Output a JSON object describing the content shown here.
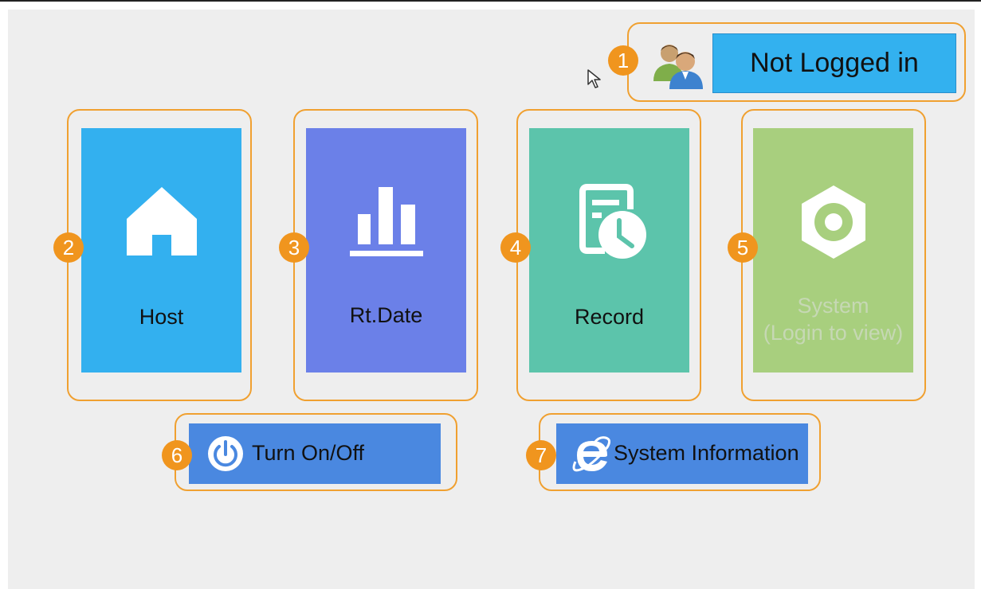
{
  "header": {
    "login_status": "Not Logged in"
  },
  "tiles": [
    {
      "id": "host",
      "label": "Host",
      "icon": "home-icon",
      "color": "#33b0ef"
    },
    {
      "id": "rt-date",
      "label": "Rt.Date",
      "icon": "bar-chart-icon",
      "color": "#6b80e8"
    },
    {
      "id": "record",
      "label": "Record",
      "icon": "record-clock-icon",
      "color": "#5cc4ab"
    },
    {
      "id": "system",
      "label_line1": "System",
      "label_line2": "(Login to view)",
      "icon": "gear-icon",
      "color": "#a8cf7e"
    }
  ],
  "buttons": {
    "power_label": "Turn On/Off",
    "info_label": "System Information"
  },
  "callouts": [
    "1",
    "2",
    "3",
    "4",
    "5",
    "6",
    "7"
  ],
  "colors": {
    "callout": "#f0951e",
    "button_blue": "#4a88e0"
  }
}
